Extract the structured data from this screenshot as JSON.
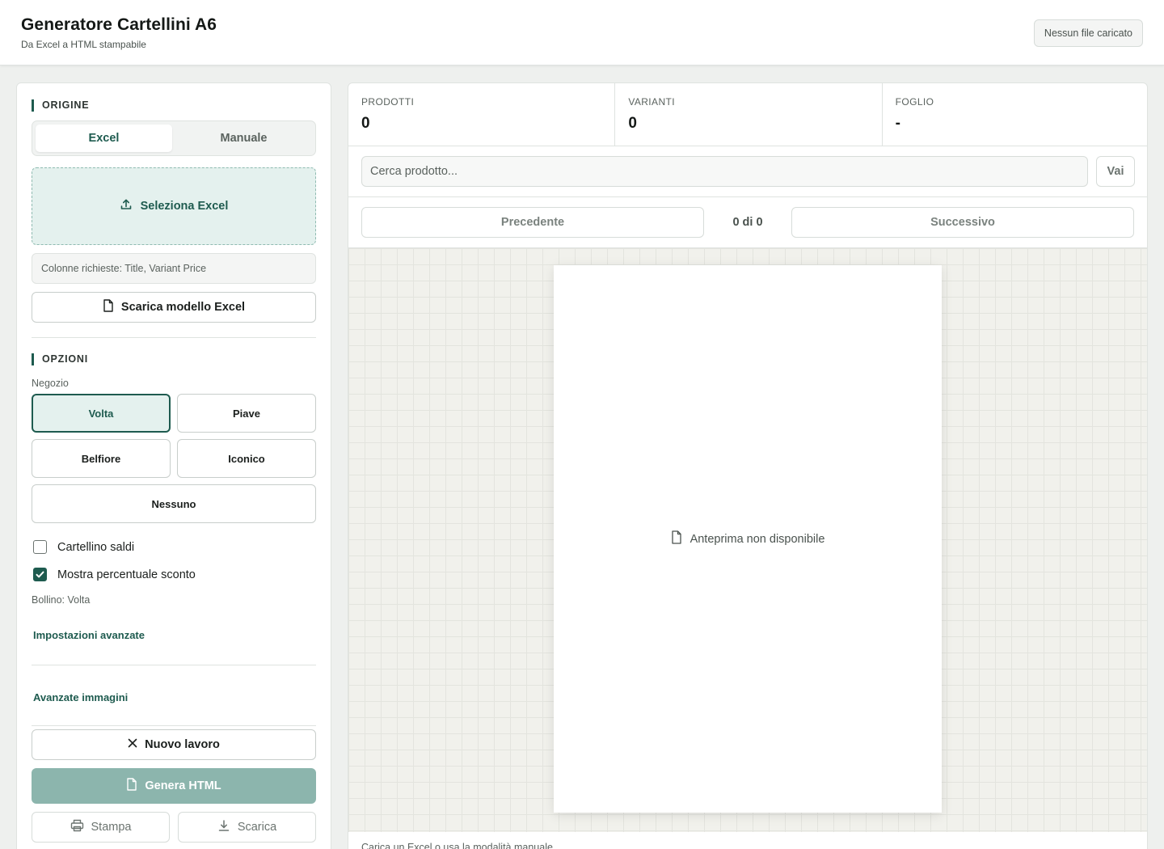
{
  "header": {
    "title": "Generatore Cartellini A6",
    "subtitle": "Da Excel a HTML stampabile",
    "file_status": "Nessun file caricato"
  },
  "sidebar": {
    "origin_title": "ORIGINE",
    "mode_tabs": [
      {
        "label": "Excel",
        "active": true
      },
      {
        "label": "Manuale",
        "active": false
      }
    ],
    "upload_label": "Seleziona Excel",
    "required_columns": "Colonne richieste: Title, Variant Price",
    "download_template_label": "Scarica modello Excel",
    "options_title": "OPZIONI",
    "shop_label": "Negozio",
    "shops": [
      {
        "label": "Volta",
        "selected": true
      },
      {
        "label": "Piave",
        "selected": false
      },
      {
        "label": "Belfiore",
        "selected": false
      },
      {
        "label": "Iconico",
        "selected": false
      },
      {
        "label": "Nessuno",
        "selected": false
      }
    ],
    "checkboxes": [
      {
        "label": "Cartellino saldi",
        "checked": false
      },
      {
        "label": "Mostra percentuale sconto",
        "checked": true
      }
    ],
    "badge_text": "Bollino: Volta",
    "advanced_settings_label": "Impostazioni avanzate",
    "advanced_images_label": "Avanzate immagini",
    "new_job_label": "Nuovo lavoro",
    "generate_label": "Genera HTML",
    "print_label": "Stampa",
    "download_label": "Scarica"
  },
  "main": {
    "stats": [
      {
        "label": "PRODOTTI",
        "value": "0"
      },
      {
        "label": "VARIANTI",
        "value": "0"
      },
      {
        "label": "FOGLIO",
        "value": "-"
      }
    ],
    "search": {
      "placeholder": "Cerca prodotto...",
      "go_label": "Vai"
    },
    "pager": {
      "prev_label": "Precedente",
      "count": "0 di 0",
      "next_label": "Successivo"
    },
    "preview_empty": "Anteprima non disponibile",
    "footer_hint": "Carica un Excel o usa la modalità manuale"
  },
  "colors": {
    "accent": "#1e5b4f",
    "accent_light": "#e4f1ee",
    "primary_disabled": "#8cb5ad"
  },
  "icons": {
    "upload": "upload-icon",
    "file": "file-icon",
    "close": "close-icon",
    "print": "printer-icon",
    "download": "download-icon",
    "check": "check-icon"
  }
}
